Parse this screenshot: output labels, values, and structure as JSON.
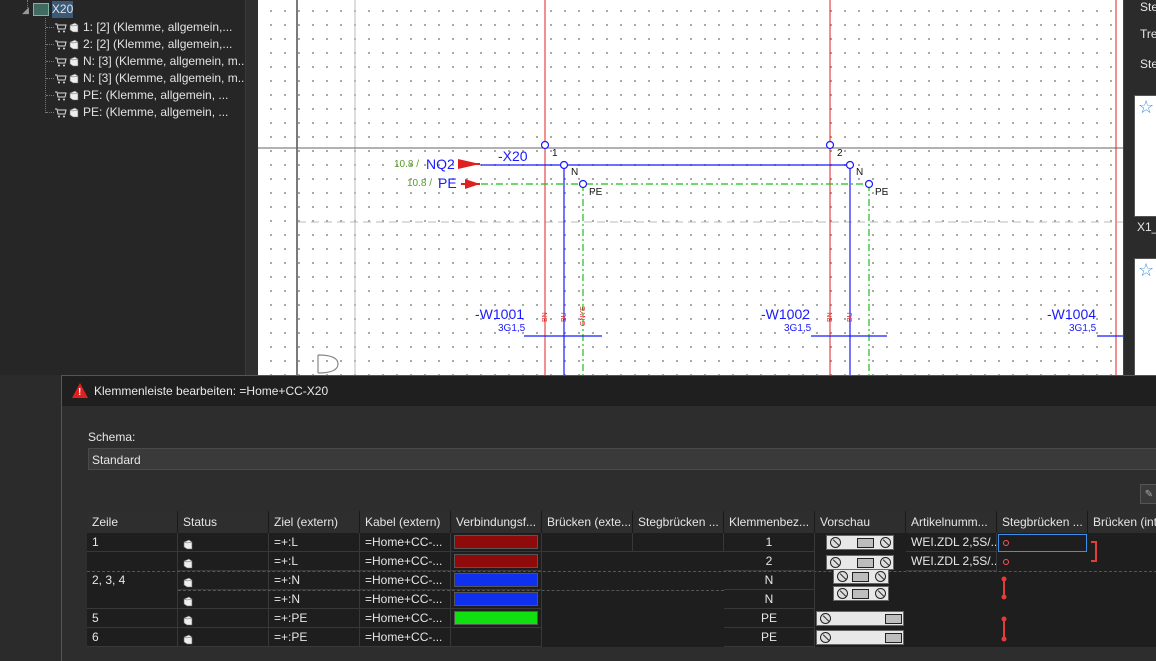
{
  "tree": {
    "root": {
      "label": "X20"
    },
    "items": [
      {
        "label": "1: [2] (Klemme, allgemein,..."
      },
      {
        "label": "2: [2] (Klemme, allgemein,..."
      },
      {
        "label": "N: [3] (Klemme, allgemein, m..."
      },
      {
        "label": "N: [3] (Klemme, allgemein, m..."
      },
      {
        "label": "PE: (Klemme, allgemein, ..."
      },
      {
        "label": "PE: (Klemme, allgemein, ..."
      }
    ]
  },
  "canvas": {
    "terminal_strip": "-X20",
    "ref_nq2": "10.8 /",
    "sig_nq2": "NQ2",
    "ref_pe": "10.8 /",
    "sig_pe": "PE",
    "pin1": "1",
    "pin2": "2",
    "n_left": "N",
    "n_right": "N",
    "pe_left": "PE",
    "pe_right": "PE",
    "letter_d": "D",
    "cables": [
      {
        "name": "-W1001",
        "type": "3G1,5",
        "cores": [
          "BN",
          "BU",
          "GNYE"
        ]
      },
      {
        "name": "-W1002",
        "type": "3G1,5",
        "cores": [
          "BN",
          "BU"
        ]
      },
      {
        "name": "-W1004",
        "type": "3G1,5",
        "cores": []
      }
    ]
  },
  "right_panel": {
    "items": [
      "Ste",
      "Tre",
      "Ste"
    ],
    "thumb_label": "X1_"
  },
  "dialog": {
    "title": "Klemmenleiste bearbeiten: =Home+CC-X20",
    "schema_label": "Schema:",
    "schema_value": "Standard",
    "columns": [
      "Zeile",
      "Status",
      "Ziel (extern)",
      "Kabel (extern)",
      "Verbindungsf...",
      "Brücken (exte...",
      "Stegbrücken ...",
      "Klemmenbez...",
      "Vorschau",
      "Artikelnumm...",
      "Stegbrücken ...",
      "Brücken (int"
    ],
    "rows": [
      {
        "zeile": "1",
        "ziel": "=+:L",
        "kabel": "=Home+CC-...",
        "color": "#8f0b0b",
        "bez": "1",
        "artikel": "WEI.ZDL 2,5S/..."
      },
      {
        "zeile": "",
        "ziel": "=+:L",
        "kabel": "=Home+CC-...",
        "color": "#8f0b0b",
        "bez": "2",
        "artikel": "WEI.ZDL 2,5S/..."
      },
      {
        "zeile": "2, 3, 4",
        "ziel": "=+:N",
        "kabel": "=Home+CC-...",
        "color": "#1030f0",
        "bez": "N",
        "artikel": ""
      },
      {
        "zeile": "",
        "ziel": "=+:N",
        "kabel": "=Home+CC-...",
        "color": "#1030f0",
        "bez": "N",
        "artikel": ""
      },
      {
        "zeile": "5",
        "ziel": "=+:PE",
        "kabel": "=Home+CC-...",
        "color": "#10e010",
        "bez": "PE",
        "artikel": ""
      },
      {
        "zeile": "6",
        "ziel": "=+:PE",
        "kabel": "=Home+CC-...",
        "color": "",
        "bez": "PE",
        "artikel": ""
      }
    ]
  },
  "colors": {
    "accent": "#3b8eea",
    "wire_blue": "#1a1aff",
    "wire_red": "#e02020",
    "wire_green": "#18c018"
  }
}
